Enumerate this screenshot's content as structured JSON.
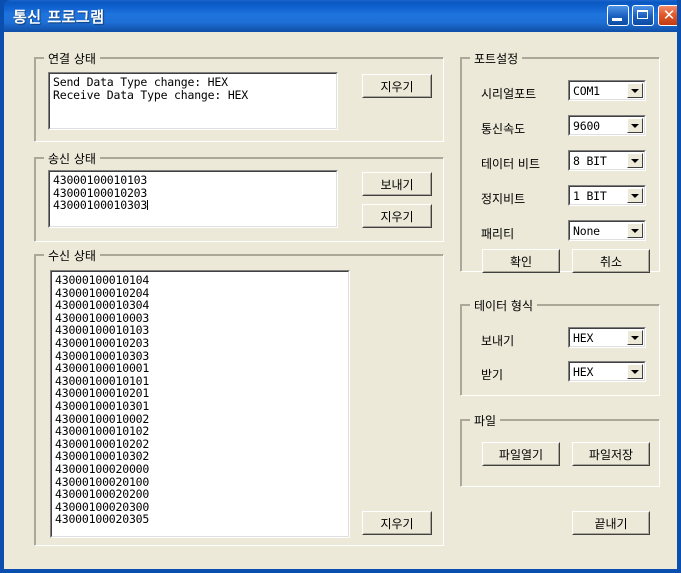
{
  "window": {
    "title": "통신 프로그램",
    "controls": {
      "minimize": "minimize-icon",
      "maximize": "maximize-icon",
      "close": "✕"
    },
    "colors": {
      "titlebar_blue": "#0d5ecb",
      "client_beige": "#ece9d8",
      "close_red": "#e25a2a",
      "edit_white": "#ffffff",
      "border_shadow": "#aca899"
    }
  },
  "connection_status": {
    "title": "연결 상태",
    "lines": [
      "Send Data Type change: HEX",
      "Receive Data Type change: HEX"
    ],
    "clear_button": "지우기"
  },
  "send_status": {
    "title": "송신 상태",
    "lines": [
      "43000100010103",
      "43000100010203",
      "43000100010303"
    ],
    "send_button": "보내기",
    "clear_button": "지우기"
  },
  "receive_status": {
    "title": "수신 상태",
    "lines": [
      "43000100010104",
      "43000100010204",
      "43000100010304",
      "43000100010003",
      "43000100010103",
      "43000100010203",
      "43000100010303",
      "43000100010001",
      "43000100010101",
      "43000100010201",
      "43000100010301",
      "43000100010002",
      "43000100010102",
      "43000100010202",
      "43000100010302",
      "43000100020000",
      "43000100020100",
      "43000100020200",
      "43000100020300",
      "43000100020305"
    ],
    "clear_button": "지우기"
  },
  "port_settings": {
    "title": "포트설정",
    "fields": [
      {
        "label": "시리얼포트",
        "value": "COM1"
      },
      {
        "label": "통신속도",
        "value": "9600"
      },
      {
        "label": "테이터 비트",
        "value": "8 BIT"
      },
      {
        "label": "정지비트",
        "value": "1 BIT"
      },
      {
        "label": "패리티",
        "value": "None"
      }
    ],
    "ok_button": "확인",
    "cancel_button": "취소"
  },
  "data_format": {
    "title": "테이터 형식",
    "fields": [
      {
        "label": "보내기",
        "value": "HEX"
      },
      {
        "label": "받기",
        "value": "HEX"
      }
    ]
  },
  "file": {
    "title": "파일",
    "open_button": "파일열기",
    "save_button": "파일저장"
  },
  "exit_button": "끝내기"
}
